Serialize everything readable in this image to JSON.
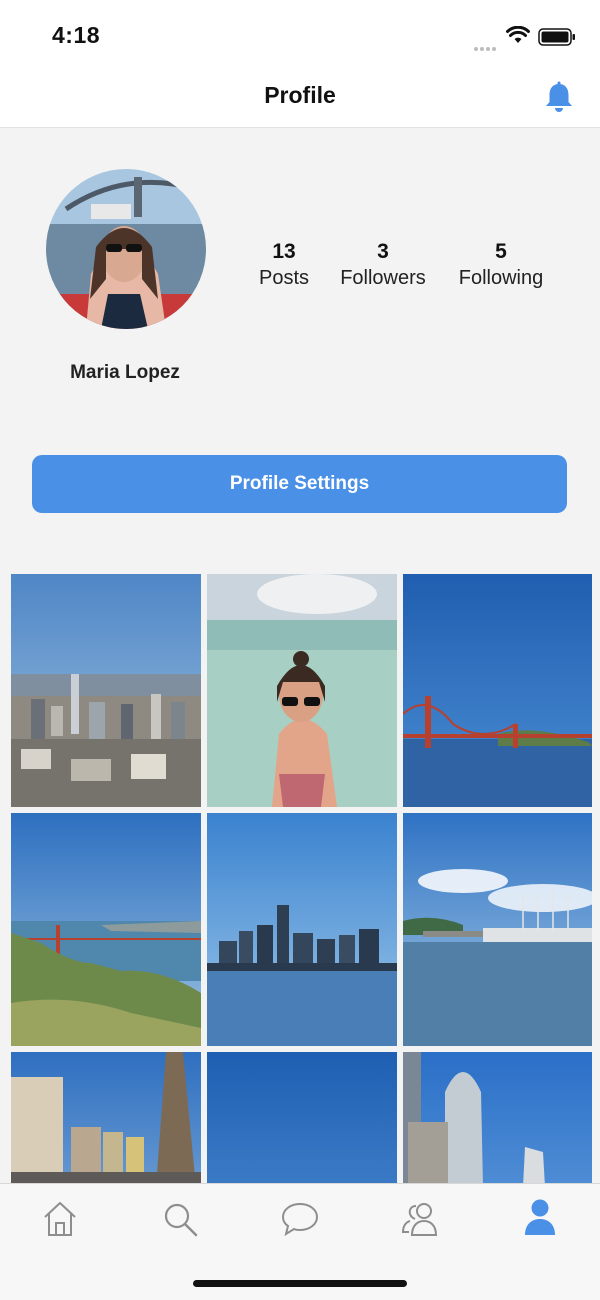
{
  "status_bar": {
    "time": "4:18"
  },
  "nav": {
    "title": "Profile",
    "bell_icon": "bell-icon"
  },
  "profile": {
    "name": "Maria Lopez",
    "stats": [
      {
        "value": "13",
        "label": "Posts"
      },
      {
        "value": "3",
        "label": "Followers"
      },
      {
        "value": "5",
        "label": "Following"
      }
    ],
    "settings_label": "Profile Settings"
  },
  "tabs": [
    {
      "icon": "home-icon",
      "selected": false
    },
    {
      "icon": "search-icon",
      "selected": false
    },
    {
      "icon": "chat-icon",
      "selected": false
    },
    {
      "icon": "friends-icon",
      "selected": false
    },
    {
      "icon": "person-icon",
      "selected": true
    }
  ],
  "colors": {
    "accent": "#4a90e7",
    "tab_inactive": "#8e8e8e"
  }
}
